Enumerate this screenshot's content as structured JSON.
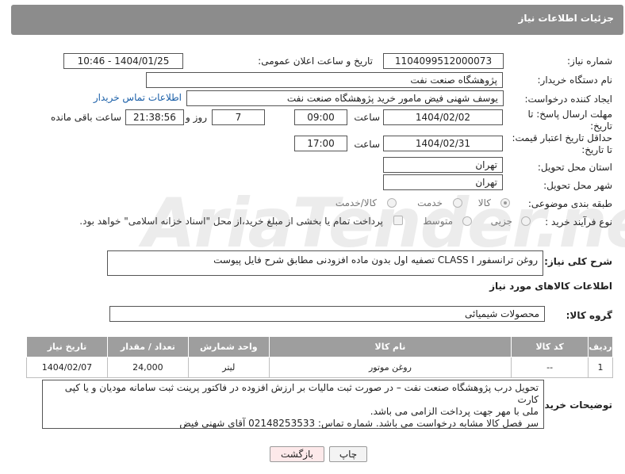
{
  "header": {
    "title": "جزئیات اطلاعات نیاز"
  },
  "watermark": "AriaTender.neT",
  "form": {
    "need_number_label": "شماره نیاز:",
    "need_number": "1104099512000073",
    "announce_label": "تاریخ و ساعت اعلان عمومی:",
    "announce_value": "1404/01/25 - 10:46",
    "buyer_org_label": "نام دستگاه خریدار:",
    "buyer_org": "پژوهشگاه صنعت نفت",
    "creator_label": "ایجاد کننده درخواست:",
    "creator": "یوسف شهنی فیض مامور خرید پژوهشگاه صنعت نفت",
    "contact_link": "اطلاعات تماس خریدار",
    "deadline_label_1": "مهلت ارسال پاسخ: تا",
    "deadline_label_2": "تاریخ:",
    "deadline_date": "1404/02/02",
    "time_label": "ساعت",
    "deadline_time": "09:00",
    "days_value": "7",
    "days_label": "روز و",
    "remaining_time": "21:38:56",
    "remaining_label": "ساعت باقی مانده",
    "validity_label_1": "حداقل تاریخ اعتبار قیمت:",
    "validity_label_2": "تا تاریخ:",
    "validity_date": "1404/02/31",
    "validity_time": "17:00",
    "province_label": "استان محل تحویل:",
    "province": "تهران",
    "city_label": "شهر محل تحویل:",
    "city": "تهران",
    "category_label": "طبقه بندی موضوعی:",
    "category_options": [
      "کالا",
      "خدمت",
      "کالا/خدمت"
    ],
    "category_selected": "کالا",
    "process_label": "نوع فرآیند خرید :",
    "process_options": [
      "جزیی",
      "متوسط"
    ],
    "payment_note": "پرداخت تمام یا بخشی از مبلغ خرید،از محل \"اسناد خزانه اسلامی\" خواهد بود."
  },
  "description": {
    "label": "شرح کلی نیاز:",
    "text": "روغن ترانسفور CLASS I تصفیه اول بدون ماده افزودنی مطابق شرح فایل پیوست"
  },
  "goods_info": {
    "title": "اطلاعات کالاهای مورد نیاز",
    "group_label": "گروه کالا:",
    "group_value": "محصولات شیمیائی"
  },
  "table": {
    "headers": [
      "ردیف",
      "کد کالا",
      "نام کالا",
      "واحد شمارش",
      "تعداد / مقدار",
      "تاریخ نیاز"
    ],
    "rows": [
      [
        "1",
        "--",
        "روغن موتور",
        "لیتر",
        "24,000",
        "1404/02/07"
      ]
    ]
  },
  "buyer_notes": {
    "label": "توضیحات خریدار:",
    "line1": "تحویل درب پژوهشگاه صنعت نفت – در صورت ثبت مالیات بر ارزش افزوده در فاکتور پرینت ثبت سامانه مودیان و یا کپی کارت",
    "line2": "ملی با مهر جهت پرداخت الزامی می باشد.",
    "line3": "سر فصل کالا مشابه درخواست می باشد. شماره تماس: 02148253533 آقای شهنی فیض"
  },
  "buttons": {
    "print": "چاپ",
    "back": "بازگشت"
  },
  "colors": {
    "header_bg": "#8c8c8c",
    "table_header_bg": "#9e9e9e",
    "link": "#1a5fa8",
    "back_button_bg": "#fde9ea"
  }
}
